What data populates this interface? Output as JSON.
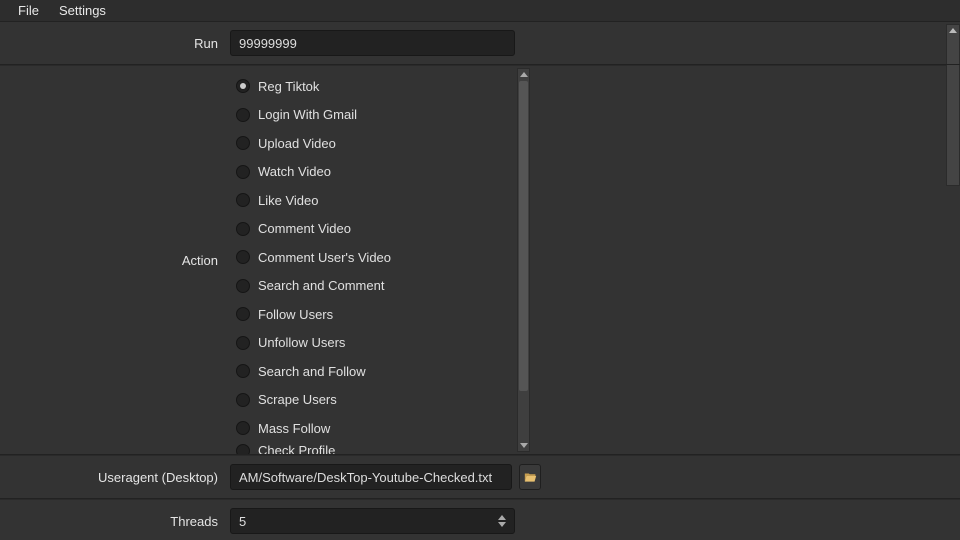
{
  "menubar": {
    "file": "File",
    "settings": "Settings"
  },
  "form": {
    "run": {
      "label": "Run",
      "value": "99999999"
    },
    "action": {
      "label": "Action",
      "options": [
        "Reg Tiktok",
        "Login With Gmail",
        "Upload Video",
        "Watch Video",
        "Like Video",
        "Comment Video",
        "Comment User's Video",
        "Search and Comment",
        "Follow Users",
        "Unfollow Users",
        "Search and Follow",
        "Scrape Users",
        "Mass Follow",
        "Check Profile"
      ],
      "selected_index": 0
    },
    "useragent": {
      "label": "Useragent (Desktop)",
      "value": "AM/Software/DeskTop-Youtube-Checked.txt"
    },
    "threads": {
      "label": "Threads",
      "value": "5"
    }
  }
}
